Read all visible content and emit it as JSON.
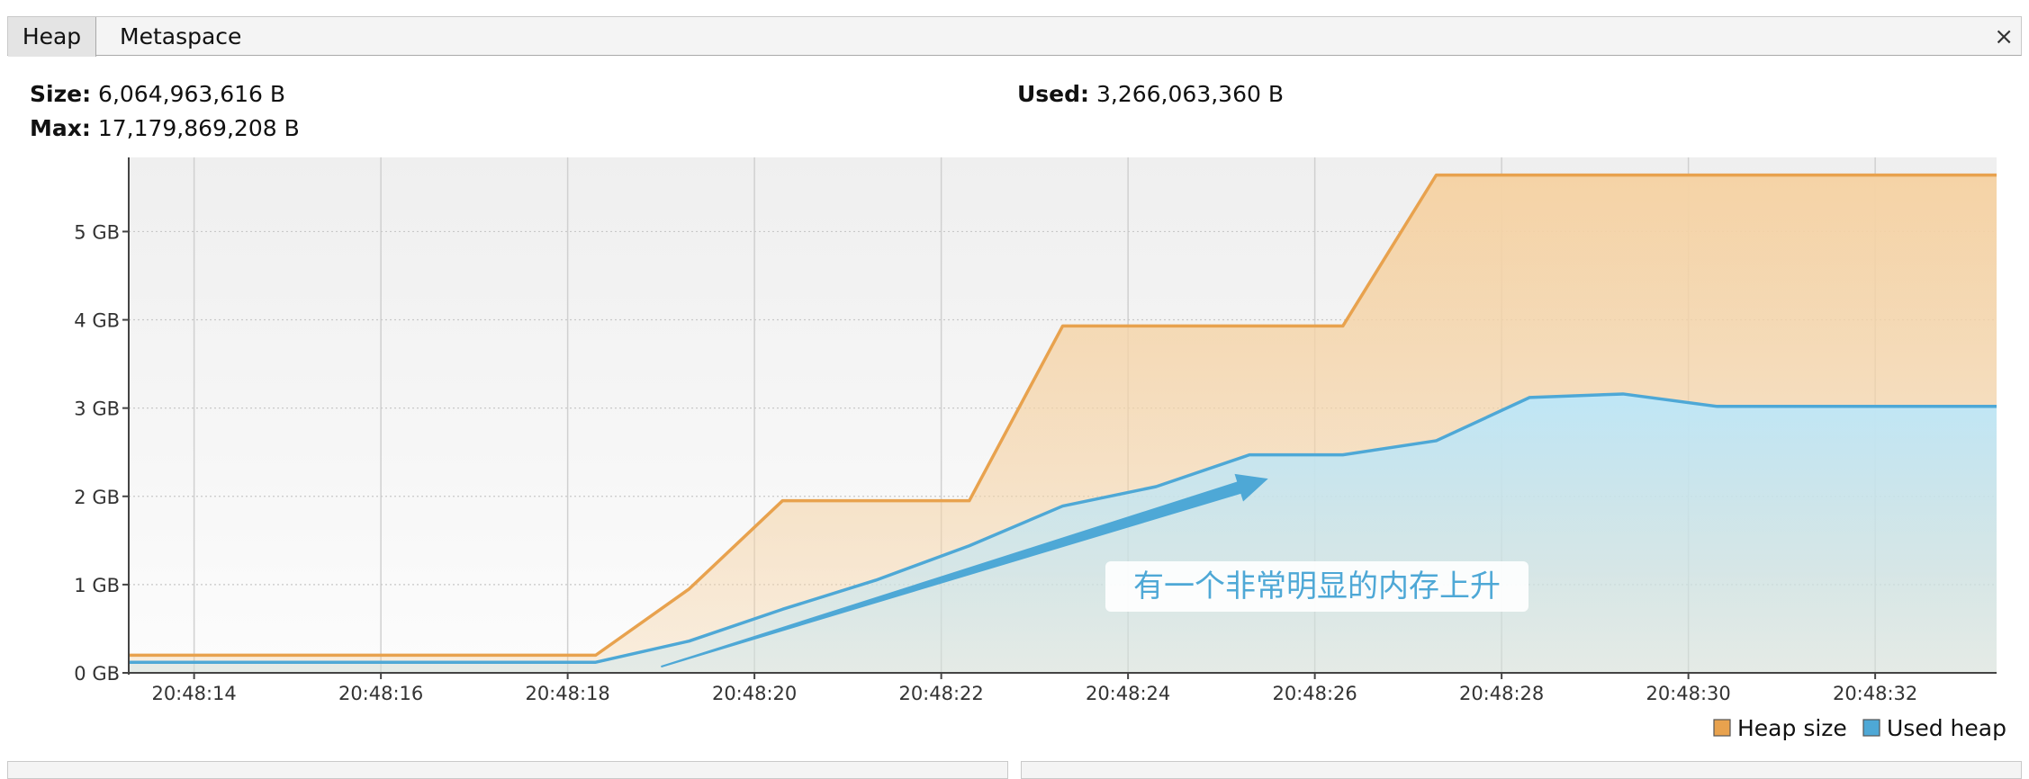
{
  "tabs": [
    {
      "label": "Heap",
      "active": true
    },
    {
      "label": "Metaspace",
      "active": false
    }
  ],
  "close_label": "×",
  "stats": {
    "size_label": "Size:",
    "size_value": "6,064,963,616 B",
    "max_label": "Max:",
    "max_value": "17,179,869,208 B",
    "used_label": "Used:",
    "used_value": "3,266,063,360 B"
  },
  "chart_data": {
    "type": "area",
    "x_ticks": [
      "20:48:14",
      "20:48:16",
      "20:48:18",
      "20:48:20",
      "20:48:22",
      "20:48:24",
      "20:48:26",
      "20:48:28",
      "20:48:30",
      "20:48:32"
    ],
    "y_ticks": [
      "0 GB",
      "1 GB",
      "2 GB",
      "3 GB",
      "4 GB",
      "5 GB"
    ],
    "xlim": [
      "20:48:13.3",
      "20:48:33.3"
    ],
    "ylim": [
      0,
      5.84
    ],
    "series": [
      {
        "name": "Heap size",
        "color": "#e8a24e",
        "fill": "#f5d3a6",
        "x": [
          "20:48:13.3",
          "20:48:18.3",
          "20:48:19.3",
          "20:48:20.3",
          "20:48:22.3",
          "20:48:23.3",
          "20:48:26.3",
          "20:48:27.3",
          "20:48:33.3"
        ],
        "y": [
          0.2,
          0.2,
          0.95,
          1.95,
          1.95,
          3.93,
          3.93,
          5.64,
          5.64
        ]
      },
      {
        "name": "Used heap",
        "color": "#4ea8d6",
        "fill": "#bfe6f6",
        "x": [
          "20:48:13.3",
          "20:48:18.3",
          "20:48:19.3",
          "20:48:20.3",
          "20:48:21.3",
          "20:48:22.3",
          "20:48:23.3",
          "20:48:24.3",
          "20:48:25.3",
          "20:48:26.3",
          "20:48:27.3",
          "20:48:28.3",
          "20:48:29.3",
          "20:48:30.3",
          "20:48:33.3"
        ],
        "y": [
          0.12,
          0.12,
          0.36,
          0.72,
          1.05,
          1.44,
          1.89,
          2.11,
          2.47,
          2.47,
          2.63,
          3.12,
          3.16,
          3.02,
          3.02
        ]
      }
    ],
    "grid": true,
    "legend": {
      "placement": "bottom-right",
      "items": [
        "Heap size",
        "Used heap"
      ]
    },
    "annotation": {
      "text": "有一个非常明显的内存上升",
      "arrow_from": [
        "20:48:19",
        0.07
      ],
      "arrow_to": [
        "20:48:25.5",
        2.2
      ]
    }
  }
}
